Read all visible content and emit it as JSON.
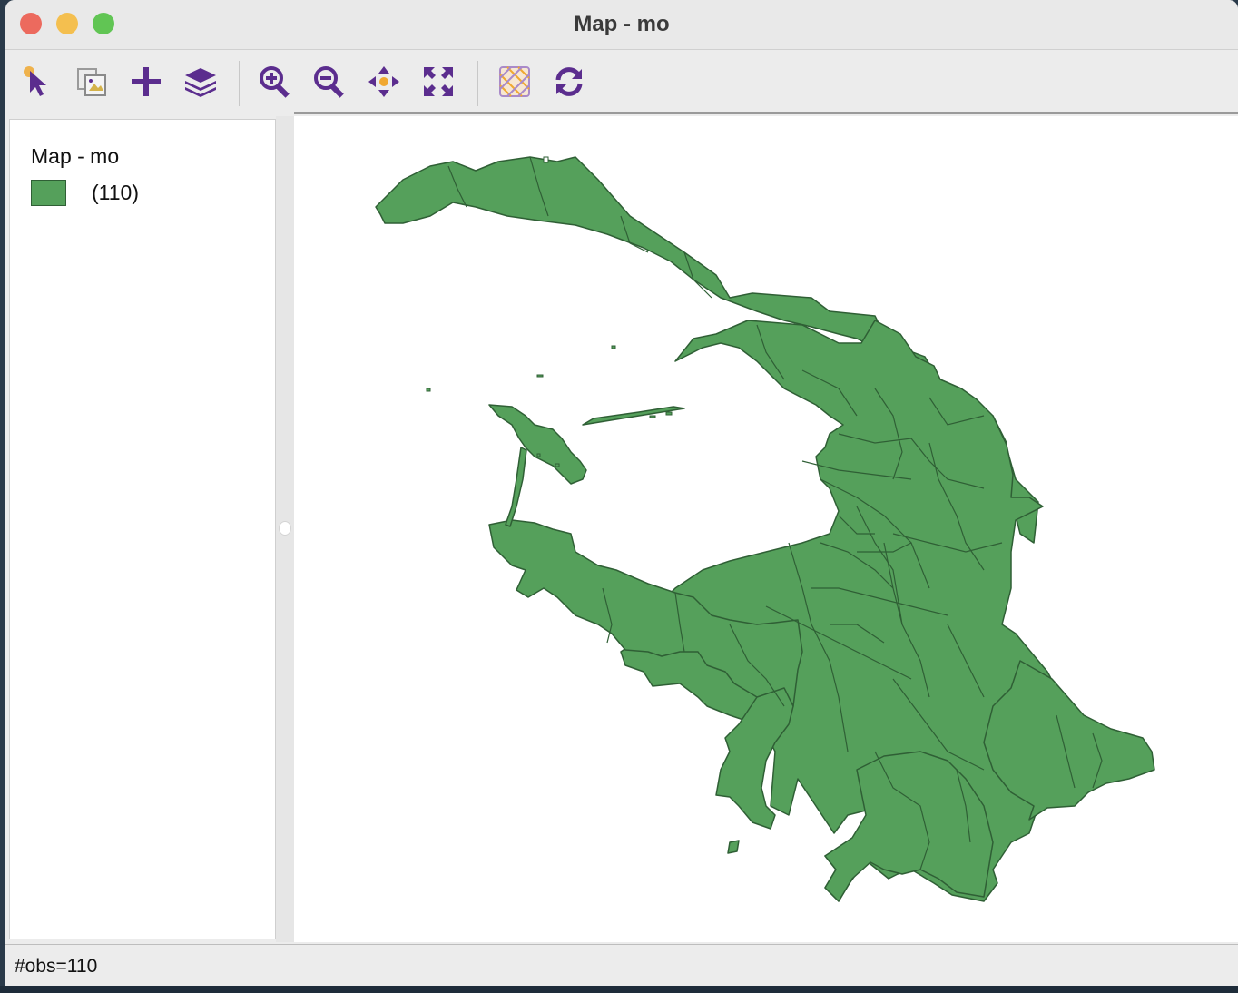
{
  "window": {
    "title": "Map - mo",
    "traffic_lights": {
      "close": "#ec6a5e",
      "minimize": "#f4bf4f",
      "zoom": "#61c554"
    }
  },
  "toolbar": {
    "icons": [
      "select-pointer-icon",
      "copy-image-icon",
      "add-layer-icon",
      "layers-icon",
      "zoom-in-icon",
      "zoom-out-icon",
      "pan-icon",
      "fit-extent-icon",
      "map-theme-icon",
      "refresh-icon"
    ],
    "icon_color": "#5b2d8e",
    "accent_color": "#f0a830"
  },
  "legend": {
    "title": "Map - mo",
    "items": [
      {
        "label": "(110)",
        "color": "#55a05b",
        "border": "#2f5f35"
      }
    ]
  },
  "map": {
    "fill": "#55a05b",
    "stroke": "#2f5f35",
    "feature_count": 110
  },
  "status": {
    "text": "#obs=110"
  }
}
